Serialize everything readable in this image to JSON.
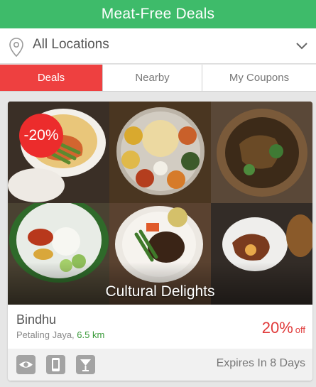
{
  "header": {
    "title": "Meat-Free Deals"
  },
  "location": {
    "label": "All Locations"
  },
  "tabs": [
    {
      "label": "Deals",
      "active": true
    },
    {
      "label": "Nearby",
      "active": false
    },
    {
      "label": "My Coupons",
      "active": false
    }
  ],
  "deal": {
    "discount_badge": "-20%",
    "collection_title": "Cultural Delights",
    "merchant": "Bindhu",
    "area": "Petaling Jaya,",
    "distance": "6.5 km",
    "discount_value": "20%",
    "discount_suffix": "off",
    "expires": "Expires In 8 Days",
    "footer_icons": [
      "eye-icon",
      "phone-icon",
      "cocktail-icon"
    ]
  },
  "colors": {
    "header_bg": "#3ebb6a",
    "active_tab_bg": "#ee4040",
    "badge_bg": "#ec2c2c",
    "price_text": "#e03a3a",
    "distance_text": "#3a9a3a"
  }
}
